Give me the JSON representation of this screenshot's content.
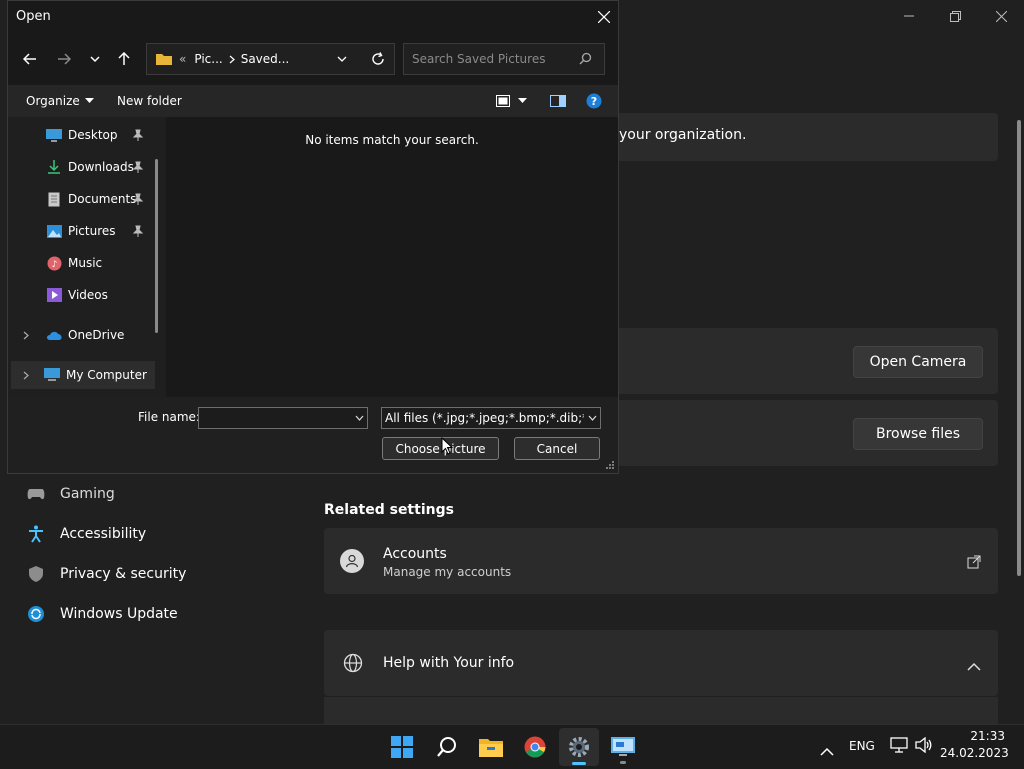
{
  "settings": {
    "org_text": "your organization.",
    "open_camera": "Open Camera",
    "browse_files": "Browse files",
    "related_settings": "Related settings",
    "accounts_title": "Accounts",
    "accounts_sub": "Manage my accounts",
    "help_title": "Help with Your info",
    "sidebar": [
      {
        "label": "Gaming",
        "icon": "gamepad-icon"
      },
      {
        "label": "Accessibility",
        "icon": "accessibility-icon"
      },
      {
        "label": "Privacy & security",
        "icon": "shield-icon"
      },
      {
        "label": "Windows Update",
        "icon": "update-icon"
      }
    ]
  },
  "dialog": {
    "title": "Open",
    "breadcrumb_1": "Pic...",
    "breadcrumb_2": "Saved...",
    "breadcrumb_prefix": "«",
    "search_placeholder": "Search Saved Pictures",
    "organize": "Organize",
    "new_folder": "New folder",
    "empty_message": "No items match your search.",
    "nav": [
      {
        "label": "Desktop",
        "pinned": true
      },
      {
        "label": "Downloads",
        "pinned": true
      },
      {
        "label": "Documents",
        "pinned": true
      },
      {
        "label": "Pictures",
        "pinned": true
      },
      {
        "label": "Music",
        "pinned": false
      },
      {
        "label": "Videos",
        "pinned": false
      },
      {
        "label": "OneDrive",
        "pinned": false
      },
      {
        "label": "My Computer",
        "pinned": false
      }
    ],
    "file_name_label": "File name:",
    "file_name_value": "",
    "file_type": "All files (*.jpg;*.jpeg;*.bmp;*.dib;*.png",
    "choose_label": "Choose picture",
    "cancel_label": "Cancel"
  },
  "taskbar": {
    "language": "ENG",
    "time": "21:33",
    "date": "24.02.2023"
  }
}
